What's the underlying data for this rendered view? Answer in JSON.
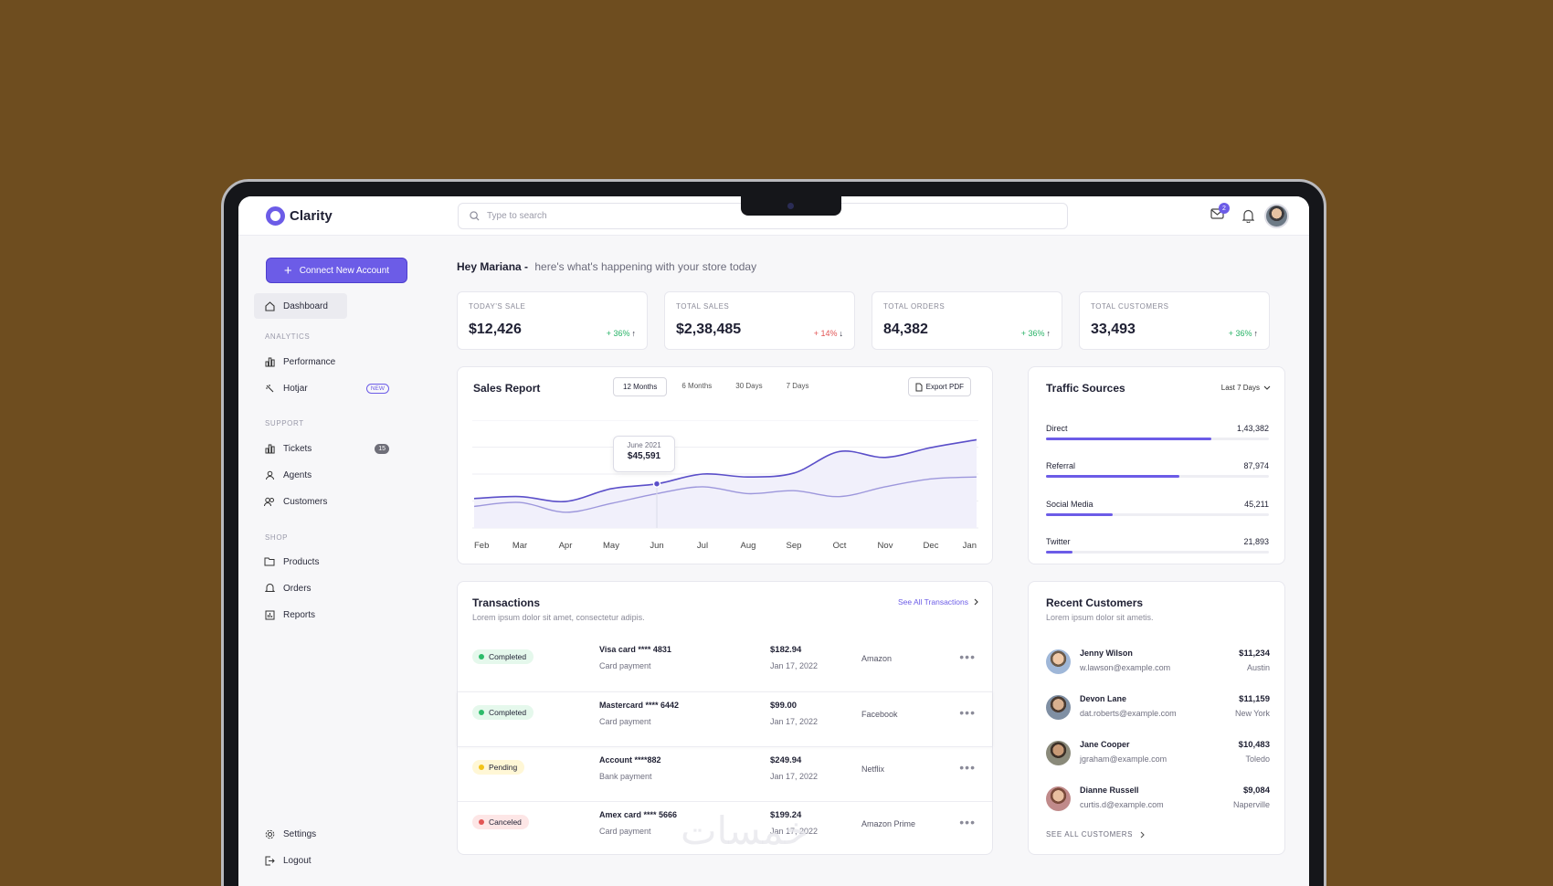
{
  "app": {
    "name": "Clarity"
  },
  "search": {
    "placeholder": "Type to search"
  },
  "topbar": {
    "mail_badge": "2"
  },
  "sidebar": {
    "cta_label": "Connect New Account",
    "dashboard": "Dashboard",
    "sections": {
      "analytics": "ANALYTICS",
      "support": "SUPPORT",
      "shop": "SHOP"
    },
    "items": {
      "performance": "Performance",
      "hotjar": "Hotjar",
      "hotjar_badge": "NEW",
      "tickets": "Tickets",
      "tickets_badge": "15",
      "agents": "Agents",
      "customers": "Customers",
      "products": "Products",
      "orders": "Orders",
      "reports": "Reports",
      "settings": "Settings",
      "logout": "Logout"
    }
  },
  "greeting": {
    "name": "Hey Mariana -",
    "message": "here's what's happening with your store today"
  },
  "stats": [
    {
      "label": "TODAY'S SALE",
      "value": "$12,426",
      "delta": "+ 36%",
      "direction": "up"
    },
    {
      "label": "TOTAL SALES",
      "value": "$2,38,485",
      "delta": "+ 14%",
      "direction": "down"
    },
    {
      "label": "TOTAL ORDERS",
      "value": "84,382",
      "delta": "+ 36%",
      "direction": "up"
    },
    {
      "label": "TOTAL CUSTOMERS",
      "value": "33,493",
      "delta": "+ 36%",
      "direction": "up"
    }
  ],
  "sales_report": {
    "title": "Sales Report",
    "ranges": [
      "12 Months",
      "6 Months",
      "30 Days",
      "7 Days"
    ],
    "selected_range": "12 Months",
    "export_label": "Export PDF",
    "tooltip": {
      "label": "June 2021",
      "value": "$45,591"
    }
  },
  "chart_data": {
    "type": "line",
    "categories": [
      "Feb",
      "Mar",
      "Apr",
      "May",
      "Jun",
      "Jul",
      "Aug",
      "Sep",
      "Oct",
      "Nov",
      "Dec",
      "Jan"
    ],
    "series": [
      {
        "values": [
          30,
          32,
          27,
          40,
          45,
          55,
          52,
          56,
          78,
          72,
          82,
          90
        ]
      },
      {
        "values": [
          22,
          26,
          16,
          25,
          35,
          42,
          35,
          38,
          32,
          42,
          50,
          52
        ]
      }
    ],
    "ylim": [
      0,
      110
    ],
    "grid": true,
    "colors": {
      "primary": "#5b4fc9",
      "secondary": "#9d97dc"
    }
  },
  "traffic": {
    "title": "Traffic Sources",
    "range": "Last 7 Days",
    "sources": [
      {
        "name": "Direct",
        "value": "1,43,382",
        "share": 0.74
      },
      {
        "name": "Referral",
        "value": "87,974",
        "share": 0.6
      },
      {
        "name": "Social Media",
        "value": "45,211",
        "share": 0.3
      },
      {
        "name": "Twitter",
        "value": "21,893",
        "share": 0.12
      }
    ]
  },
  "transactions": {
    "title": "Transactions",
    "subtitle": "Lorem ipsum dolor sit amet, consectetur adipis.",
    "see_all": "See All Transactions",
    "rows": [
      {
        "status": "Completed",
        "card": "Visa card  **** 4831",
        "type": "Card payment",
        "amount": "$182.94",
        "date": "Jan 17, 2022",
        "merchant": "Amazon"
      },
      {
        "status": "Completed",
        "card": "Mastercard  **** 6442",
        "type": "Card payment",
        "amount": "$99.00",
        "date": "Jan 17, 2022",
        "merchant": "Facebook"
      },
      {
        "status": "Pending",
        "card": "Account  ****882",
        "type": "Bank payment",
        "amount": "$249.94",
        "date": "Jan 17, 2022",
        "merchant": "Netflix"
      },
      {
        "status": "Canceled",
        "card": "Amex card  **** 5666",
        "type": "Card payment",
        "amount": "$199.24",
        "date": "Jan 17, 2022",
        "merchant": "Amazon Prime"
      }
    ]
  },
  "recent_customers": {
    "title": "Recent Customers",
    "subtitle": "Lorem ipsum dolor sit ametis.",
    "see_all": "SEE ALL CUSTOMERS",
    "customers": [
      {
        "name": "Jenny Wilson",
        "email": "w.lawson@example.com",
        "amount": "$11,234",
        "city": "Austin"
      },
      {
        "name": "Devon Lane",
        "email": "dat.roberts@example.com",
        "amount": "$11,159",
        "city": "New York"
      },
      {
        "name": "Jane Cooper",
        "email": "jgraham@example.com",
        "amount": "$10,483",
        "city": "Toledo"
      },
      {
        "name": "Dianne Russell",
        "email": "curtis.d@example.com",
        "amount": "$9,084",
        "city": "Naperville"
      }
    ]
  },
  "watermark": "خمسات"
}
